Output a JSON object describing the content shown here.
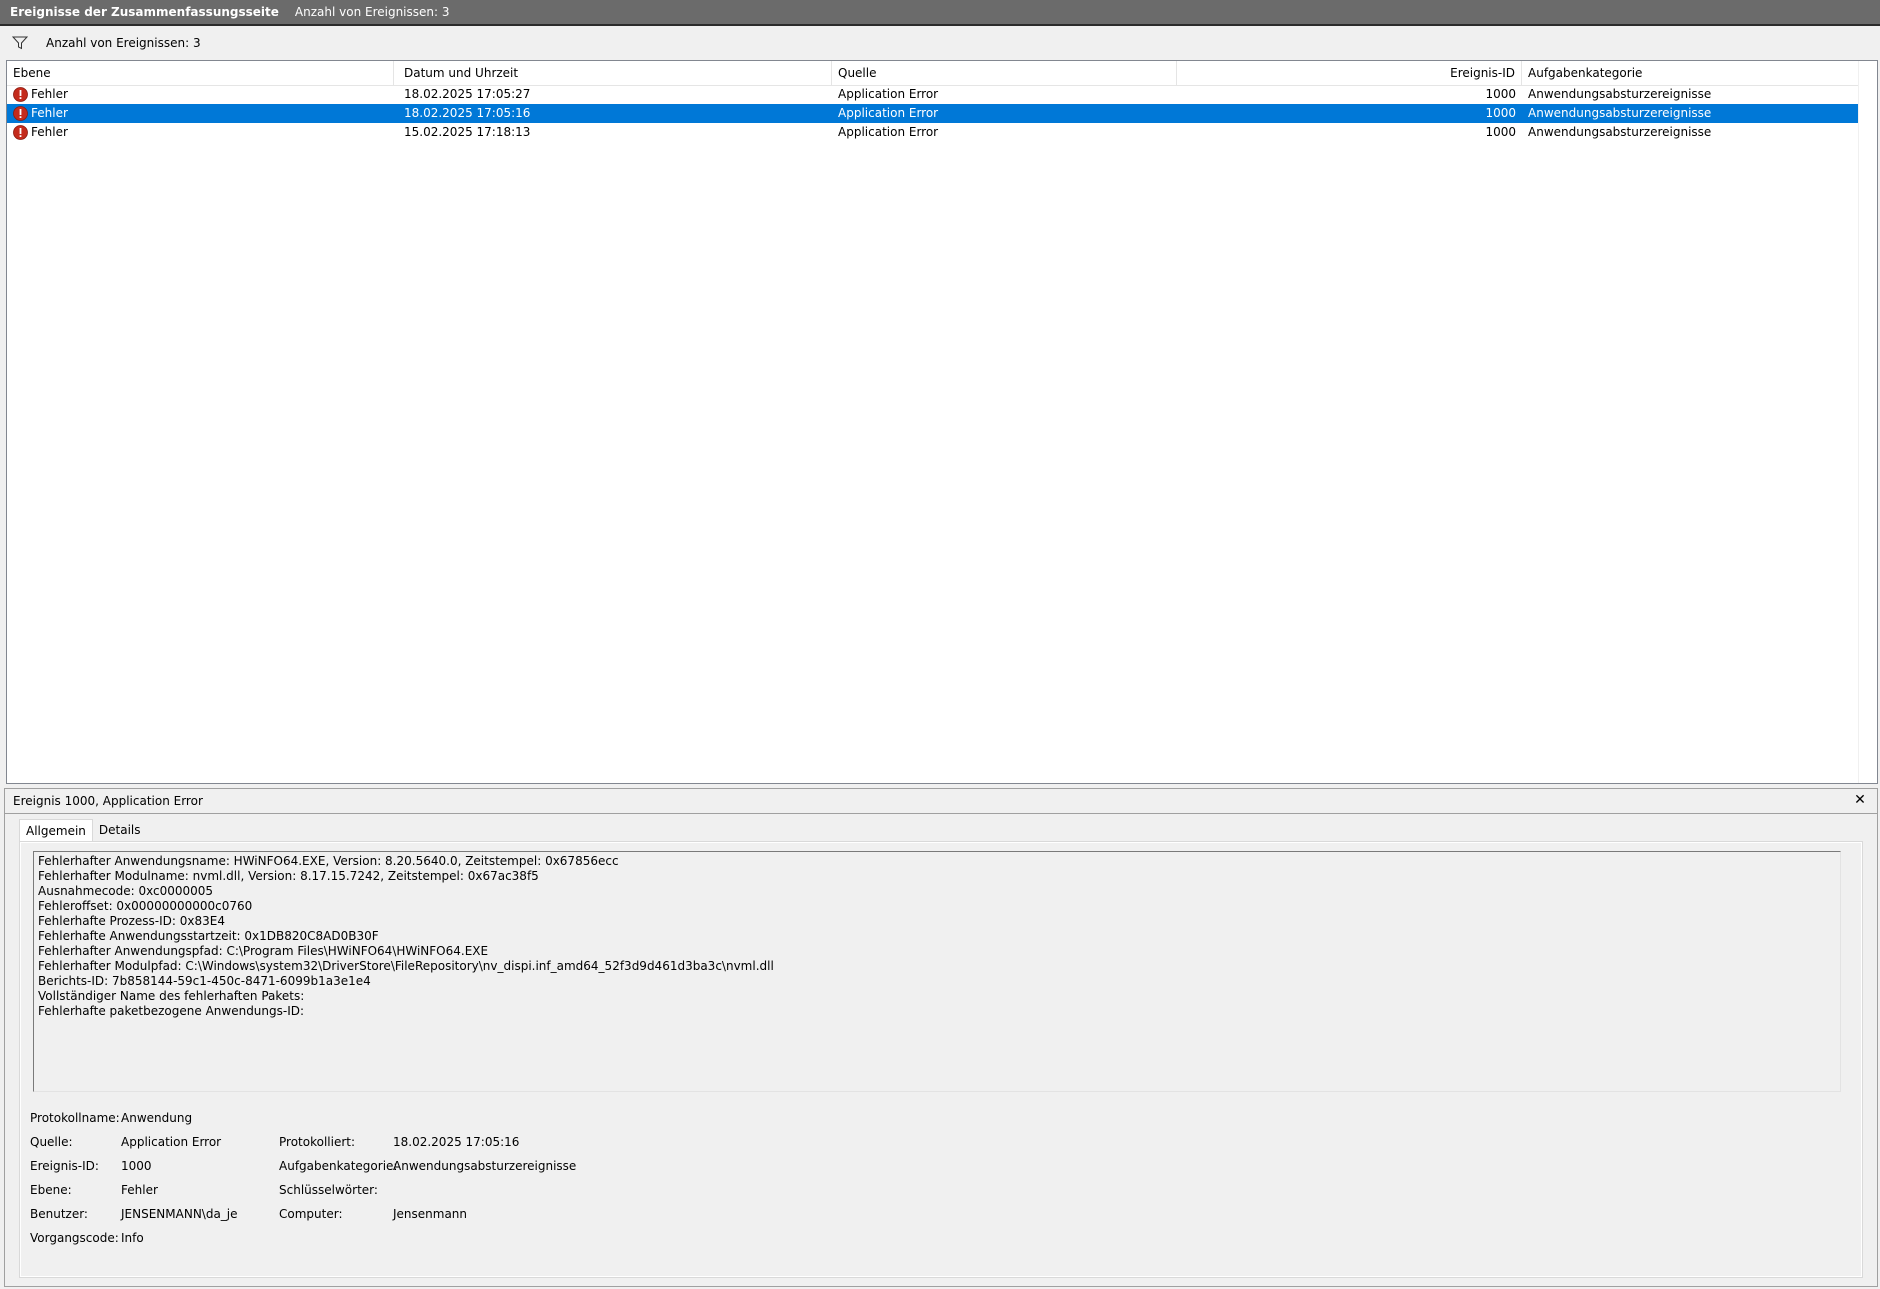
{
  "titlebar": {
    "title": "Ereignisse der Zusammenfassungsseite",
    "count": "Anzahl von Ereignissen: 3"
  },
  "filterbar": {
    "icon": "filter-icon",
    "count": "Anzahl von Ereignissen: 3"
  },
  "table": {
    "columns": [
      "Ebene",
      "Datum und Uhrzeit",
      "Quelle",
      "Ereignis-ID",
      "Aufgabenkategorie"
    ],
    "rows": [
      {
        "level": "Fehler",
        "datetime": "18.02.2025 17:05:27",
        "source": "Application Error",
        "id": "1000",
        "category": "Anwendungsabsturzereignisse",
        "selected": false
      },
      {
        "level": "Fehler",
        "datetime": "18.02.2025 17:05:16",
        "source": "Application Error",
        "id": "1000",
        "category": "Anwendungsabsturzereignisse",
        "selected": true
      },
      {
        "level": "Fehler",
        "datetime": "15.02.2025 17:18:13",
        "source": "Application Error",
        "id": "1000",
        "category": "Anwendungsabsturzereignisse",
        "selected": false
      }
    ]
  },
  "detail": {
    "title": "Ereignis 1000, Application Error",
    "tabs": [
      "Allgemein",
      "Details"
    ],
    "description": [
      "Fehlerhafter Anwendungsname: HWiNFO64.EXE, Version: 8.20.5640.0, Zeitstempel: 0x67856ecc",
      "Fehlerhafter Modulname: nvml.dll, Version: 8.17.15.7242, Zeitstempel: 0x67ac38f5",
      "Ausnahmecode: 0xc0000005",
      "Fehleroffset: 0x00000000000c0760",
      "Fehlerhafte Prozess-ID: 0x83E4",
      "Fehlerhafte Anwendungsstartzeit: 0x1DB820C8AD0B30F",
      "Fehlerhafter Anwendungspfad: C:\\Program Files\\HWiNFO64\\HWiNFO64.EXE",
      "Fehlerhafter Modulpfad: C:\\Windows\\system32\\DriverStore\\FileRepository\\nv_dispi.inf_amd64_52f3d9d461d3ba3c\\nvml.dll",
      "Berichts-ID: 7b858144-59c1-450c-8471-6099b1a3e1e4",
      "Vollständiger Name des fehlerhaften Pakets:",
      "Fehlerhafte paketbezogene Anwendungs-ID:"
    ],
    "props": {
      "log_label": "Protokollname:",
      "log_value": "Anwendung",
      "source_label": "Quelle:",
      "source_value": "Application Error",
      "logged_label": "Protokolliert:",
      "logged_value": "18.02.2025 17:05:16",
      "id_label": "Ereignis-ID:",
      "id_value": "1000",
      "category_label": "Aufgabenkategorie:",
      "category_value": "Anwendungsabsturzereignisse",
      "level_label": "Ebene:",
      "level_value": "Fehler",
      "keywords_label": "Schlüsselwörter:",
      "keywords_value": "",
      "user_label": "Benutzer:",
      "user_value": "JENSENMANN\\da_je",
      "computer_label": "Computer:",
      "computer_value": "Jensenmann",
      "opcode_label": "Vorgangscode:",
      "opcode_value": "Info"
    }
  },
  "colors": {
    "titlebar": "#6b6b6b",
    "selection": "#0078d7",
    "error_red": "#c42b1c"
  }
}
